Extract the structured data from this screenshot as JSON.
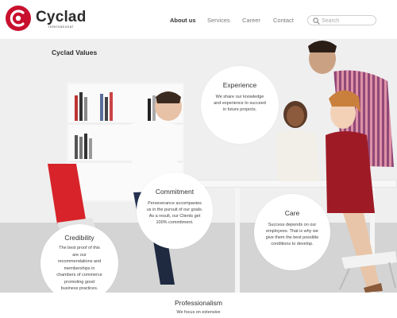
{
  "brand": {
    "name": "Cyclad",
    "tagline": "International",
    "color": "#c8102e"
  },
  "nav": {
    "items": [
      {
        "label": "About us",
        "active": true
      },
      {
        "label": "Services",
        "active": false
      },
      {
        "label": "Career",
        "active": false
      },
      {
        "label": "Contact",
        "active": false
      }
    ]
  },
  "search": {
    "placeholder": "Search",
    "icon": "search-icon"
  },
  "hero": {
    "title": "Cyclad Values",
    "values": [
      {
        "title": "Experience",
        "text": "We share our knowledge and experience to succeed in future projects."
      },
      {
        "title": "Commitment",
        "text": "Perseverance accompanies us in the pursuit of our goals. As a result, our Clients get 100% commitment."
      },
      {
        "title": "Care",
        "text": "Success depends on our employees. That is why we give them the best possible conditions to develop."
      },
      {
        "title": "Credibility",
        "text": "The best proof of this are our recommendations and memberships in chambers of commerce promoting good business practices."
      }
    ]
  },
  "band": {
    "title": "Professionalism",
    "text": "We focus on extensive"
  }
}
